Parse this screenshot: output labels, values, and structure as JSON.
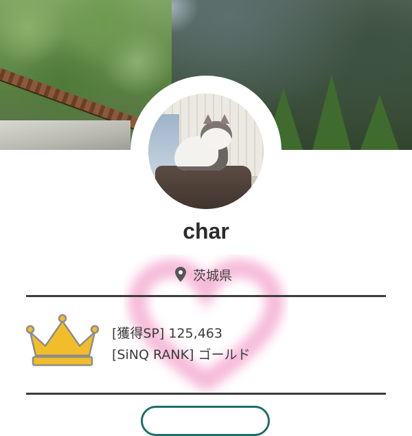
{
  "profile": {
    "name": "char",
    "location": "茨城県"
  },
  "stats": {
    "earned_sp": "[獲得SP] 125,463",
    "sinq_rank": "[SiNQ RANK] ゴールド"
  },
  "icons": {
    "location": "location-pin-icon",
    "rank": "crown-icon",
    "decoration": "heart-glow"
  },
  "colors": {
    "crown_gold": "#f2bd2a",
    "heart_pink": "#f4a9cf",
    "divider": "#3b3b3b",
    "button_border": "#1e6d6a"
  }
}
